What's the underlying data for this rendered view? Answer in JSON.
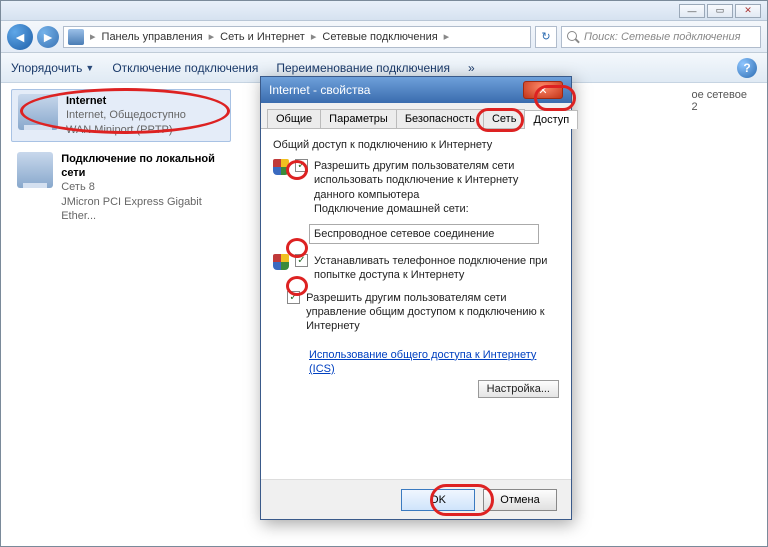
{
  "breadcrumb": {
    "items": [
      "Панель управления",
      "Сеть и Интернет",
      "Сетевые подключения"
    ]
  },
  "search": {
    "placeholder": "Поиск: Сетевые подключения"
  },
  "toolbar": {
    "organize": "Упорядочить",
    "disable": "Отключение подключения",
    "rename": "Переименование подключения",
    "more": "»"
  },
  "connections": [
    {
      "name": "Internet",
      "sub1": "Internet, Общедоступно",
      "sub2": "WAN Miniport (PPTP)"
    },
    {
      "name": "Подключение по локальной сети",
      "sub1": "Сеть 8",
      "sub2": "JMicron PCI Express Gigabit Ether..."
    }
  ],
  "right_info": {
    "line1": "ое сетевое",
    "line2": "2"
  },
  "dialog": {
    "title": "Internet - свойства",
    "tabs": [
      "Общие",
      "Параметры",
      "Безопасность",
      "Сеть",
      "Доступ"
    ],
    "section_title": "Общий доступ к подключению к Интернету",
    "check1": "Разрешить другим пользователям сети использовать подключение к Интернету данного компьютера",
    "home_net_label": "Подключение домашней сети:",
    "home_net_value": "Беспроводное сетевое соединение",
    "check2": "Устанавливать телефонное подключение при попытке доступа к Интернету",
    "check3": "Разрешить другим пользователям сети управление общим доступом к подключению к Интернету",
    "link": "Использование общего доступа к Интернету (ICS)",
    "settings_btn": "Настройка...",
    "ok": "OK",
    "cancel": "Отмена"
  }
}
